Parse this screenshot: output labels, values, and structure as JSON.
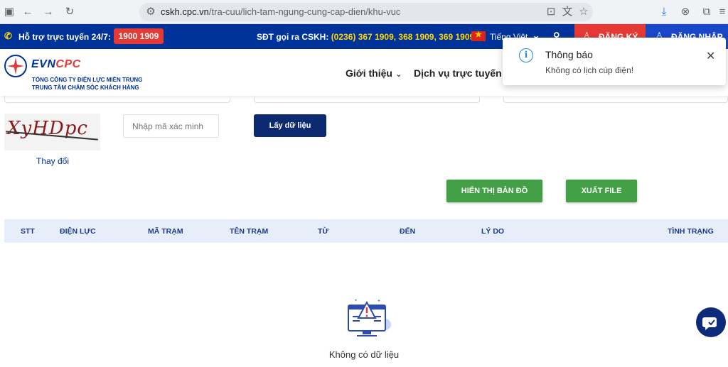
{
  "browser": {
    "url_host": "cskh.cpc.vn",
    "url_path": "/tra-cuu/lich-tam-ngung-cung-cap-dien/khu-vuc"
  },
  "topbar": {
    "support_label": "Hỗ trợ trực tuyến 24/7:",
    "hotline": "1900 1909",
    "cskh_label": "SĐT gọi ra CSKH:",
    "cskh_numbers": "(0236) 367 1909, 368 1909, 369 1909",
    "language": "Tiếng Việt",
    "register": "ĐĂNG KÝ",
    "login": "ĐĂNG NHẬP"
  },
  "header": {
    "logo_evn": "EVN",
    "logo_cpc": "CPC",
    "company_line1": "TỔNG CÔNG TY ĐIỆN LỰC MIỀN TRUNG",
    "company_line2": "TRUNG TÂM CHĂM SÓC KHÁCH HÀNG",
    "nav": [
      "Giới thiệu",
      "Dịch vụ trực tuyến"
    ]
  },
  "form": {
    "captcha_text": "XyHDpc",
    "refresh_link": "Thay đổi",
    "captcha_placeholder": "Nhập mã xác minh",
    "submit_label": "Lấy dữ liệu",
    "map_button": "HIỂN THỊ BẢN ĐỒ",
    "export_button": "XUẤT FILE"
  },
  "table": {
    "headers": [
      "STT",
      "ĐIỆN LỰC",
      "MÃ TRẠM",
      "TÊN TRẠM",
      "TỪ",
      "ĐẾN",
      "LÝ DO",
      "TÌNH TRẠNG"
    ],
    "empty_text": "Không có dữ liệu"
  },
  "notification": {
    "title": "Thông báo",
    "message": "Không có lịch cúp điện!"
  },
  "colors": {
    "brand_blue": "#003399",
    "hotline_red": "#e53935",
    "action_green": "#43a047",
    "navy_button": "#0b2a6f",
    "highlight_yellow": "#ffd600"
  },
  "icons": [
    "phone-icon",
    "search-icon",
    "user-icon",
    "info-icon",
    "close-icon",
    "chat-support-icon",
    "no-data-illustration"
  ]
}
